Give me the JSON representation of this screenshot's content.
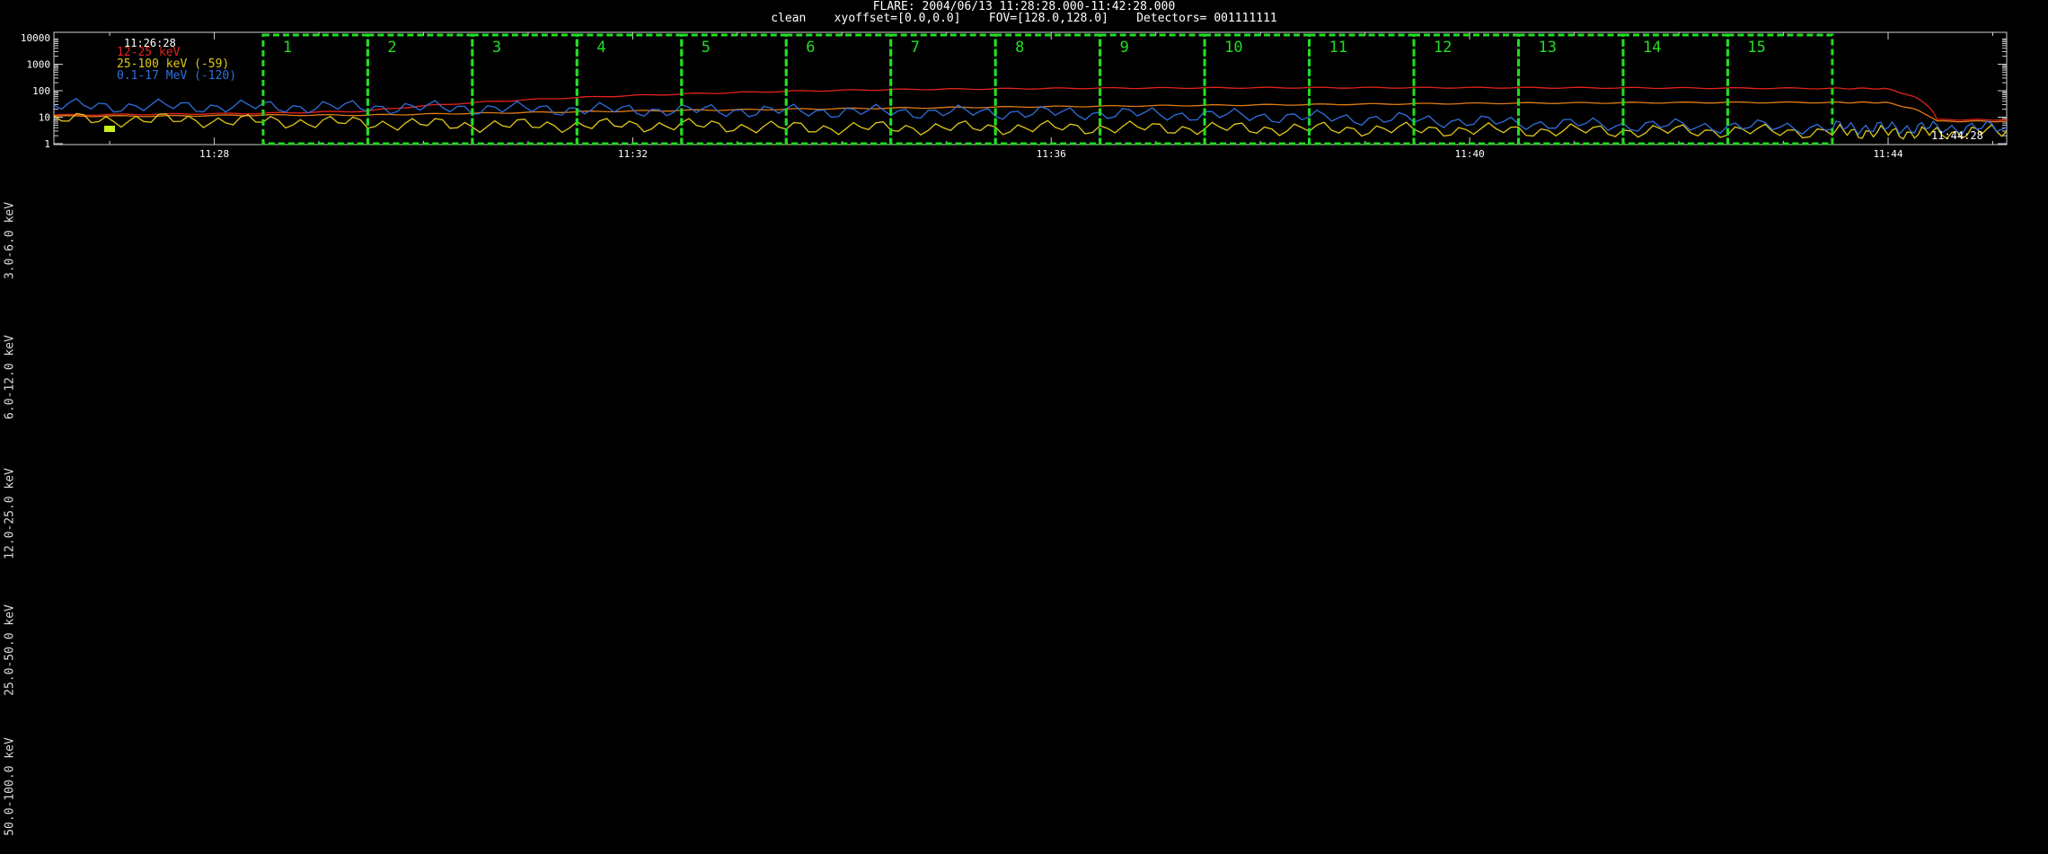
{
  "header": {
    "title": "FLARE: 2004/06/13 11:28:28.000-11:42:28.000",
    "subtitle": "clean    xyoffset=[0.0,0.0]    FOV=[128.0,128.0]    Detectors= 001111111"
  },
  "image_rows": {
    "labels": [
      "3.0-6.0 keV",
      "6.0-12.0 keV",
      "12.0-25.0 keV",
      "25.0-50.0 keV",
      "50.0-100.0 keV"
    ]
  },
  "chart_data": {
    "type": "line",
    "title": "",
    "xlabel": "",
    "ylabel": "",
    "yscale": "log",
    "ylim": [
      1,
      10000
    ],
    "xlim": [
      "11:26:28",
      "11:45:08"
    ],
    "y_ticks": [
      1,
      10,
      100,
      1000,
      10000
    ],
    "y_tick_labels": [
      "1",
      "10",
      "100",
      "1000",
      "10000"
    ],
    "x_ticks": [
      "11:28",
      "11:32",
      "11:36",
      "11:40",
      "11:44"
    ],
    "grid": false,
    "legend": "top-left",
    "legend_extra": "11:26:28",
    "corner_label": "11:44:28",
    "x": [
      "11:26:28",
      "11:27:28",
      "11:28:28",
      "11:29:28",
      "11:30:28",
      "11:31:28",
      "11:32:28",
      "11:33:28",
      "11:34:28",
      "11:35:28",
      "11:36:28",
      "11:37:28",
      "11:38:28",
      "11:39:28",
      "11:40:28",
      "11:41:28",
      "11:42:28",
      "11:43:28",
      "11:43:58",
      "11:44:28",
      "11:45:08"
    ],
    "series": [
      {
        "name": "12-25 keV",
        "color": "#e0241b",
        "values": [
          12,
          13,
          14,
          17,
          35,
          55,
          75,
          95,
          110,
          118,
          125,
          128,
          130,
          130,
          130,
          128,
          125,
          122,
          120,
          8,
          8
        ]
      },
      {
        "name": "",
        "color": "#e07b14",
        "values": [
          11,
          11,
          12,
          12,
          14,
          16,
          18,
          20,
          22,
          24,
          26,
          28,
          30,
          32,
          34,
          35,
          36,
          36,
          36,
          7,
          7
        ]
      },
      {
        "name": "25-100 keV (-59)",
        "color": "#e0c81a",
        "values": [
          8,
          8,
          7,
          6,
          5,
          5,
          5,
          4,
          4,
          4,
          4,
          3.8,
          3.6,
          3.4,
          3.2,
          3,
          3,
          2.8,
          2.6,
          2.5,
          3
        ]
      },
      {
        "name": "0.1-17 MeV (-120)",
        "color": "#2f6fdc",
        "values": [
          27,
          26,
          25,
          24,
          22,
          20,
          18,
          17,
          16,
          15,
          14,
          12,
          10,
          8,
          6,
          5,
          4.5,
          4.2,
          4,
          4,
          4
        ]
      }
    ],
    "intervals": {
      "color": "#22dd22",
      "labels": [
        "1",
        "2",
        "3",
        "4",
        "5",
        "6",
        "7",
        "8",
        "9",
        "10",
        "11",
        "12",
        "13",
        "14",
        "15"
      ],
      "start": [
        "11:28:28",
        "11:29:28",
        "11:30:28",
        "11:31:28",
        "11:32:28",
        "11:33:28",
        "11:34:28",
        "11:35:28",
        "11:36:28",
        "11:37:28",
        "11:38:28",
        "11:39:28",
        "11:40:28",
        "11:41:28",
        "11:42:28"
      ],
      "end": [
        "11:29:28",
        "11:30:28",
        "11:31:28",
        "11:32:28",
        "11:33:28",
        "11:34:28",
        "11:35:28",
        "11:36:28",
        "11:37:28",
        "11:38:28",
        "11:39:28",
        "11:40:28",
        "11:41:28",
        "11:42:28",
        "11:43:28"
      ]
    }
  }
}
